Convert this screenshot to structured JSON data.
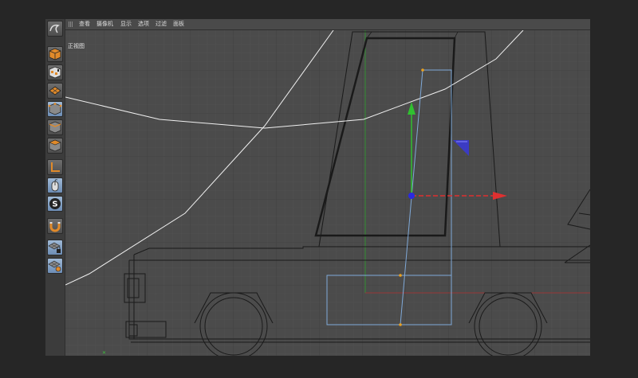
{
  "menu": {
    "items": [
      "查看",
      "摄像机",
      "显示",
      "选项",
      "过滤",
      "面板"
    ]
  },
  "viewport": {
    "label": "正视图",
    "grid": true,
    "background": "#4b4b4b"
  },
  "toolbar": {
    "buttons": [
      {
        "name": "undo-tool",
        "icon": "undo-icon",
        "active": false
      },
      {
        "name": "model-mode",
        "icon": "cube-icon",
        "active": false
      },
      {
        "name": "texture-mode",
        "icon": "checker-cube-icon",
        "active": false
      },
      {
        "name": "workplane-mode",
        "icon": "workplane-icon",
        "active": false
      },
      {
        "name": "points-mode",
        "icon": "points-cube-icon",
        "active": true
      },
      {
        "name": "edges-mode",
        "icon": "edges-cube-icon",
        "active": false
      },
      {
        "name": "polygons-mode",
        "icon": "polygons-cube-icon",
        "active": false
      },
      {
        "name": "axis-mode",
        "icon": "axis-l-icon",
        "active": false
      },
      {
        "name": "tweak-mode",
        "icon": "mouse-icon",
        "active": true
      },
      {
        "name": "solo-mode",
        "icon": "solo-s-icon",
        "active": true
      },
      {
        "name": "snap-tool",
        "icon": "magnet-icon",
        "active": false
      },
      {
        "name": "lock-workplane",
        "icon": "workplane-lock-icon",
        "active": true
      },
      {
        "name": "planar-workplane",
        "icon": "workplane-planar-icon",
        "active": true
      }
    ]
  },
  "colors": {
    "x_axis": "#e03030",
    "y_axis": "#30c030",
    "z_axis": "#3030e0",
    "selection": "#7fa9d8",
    "spline": "#ffffff"
  }
}
